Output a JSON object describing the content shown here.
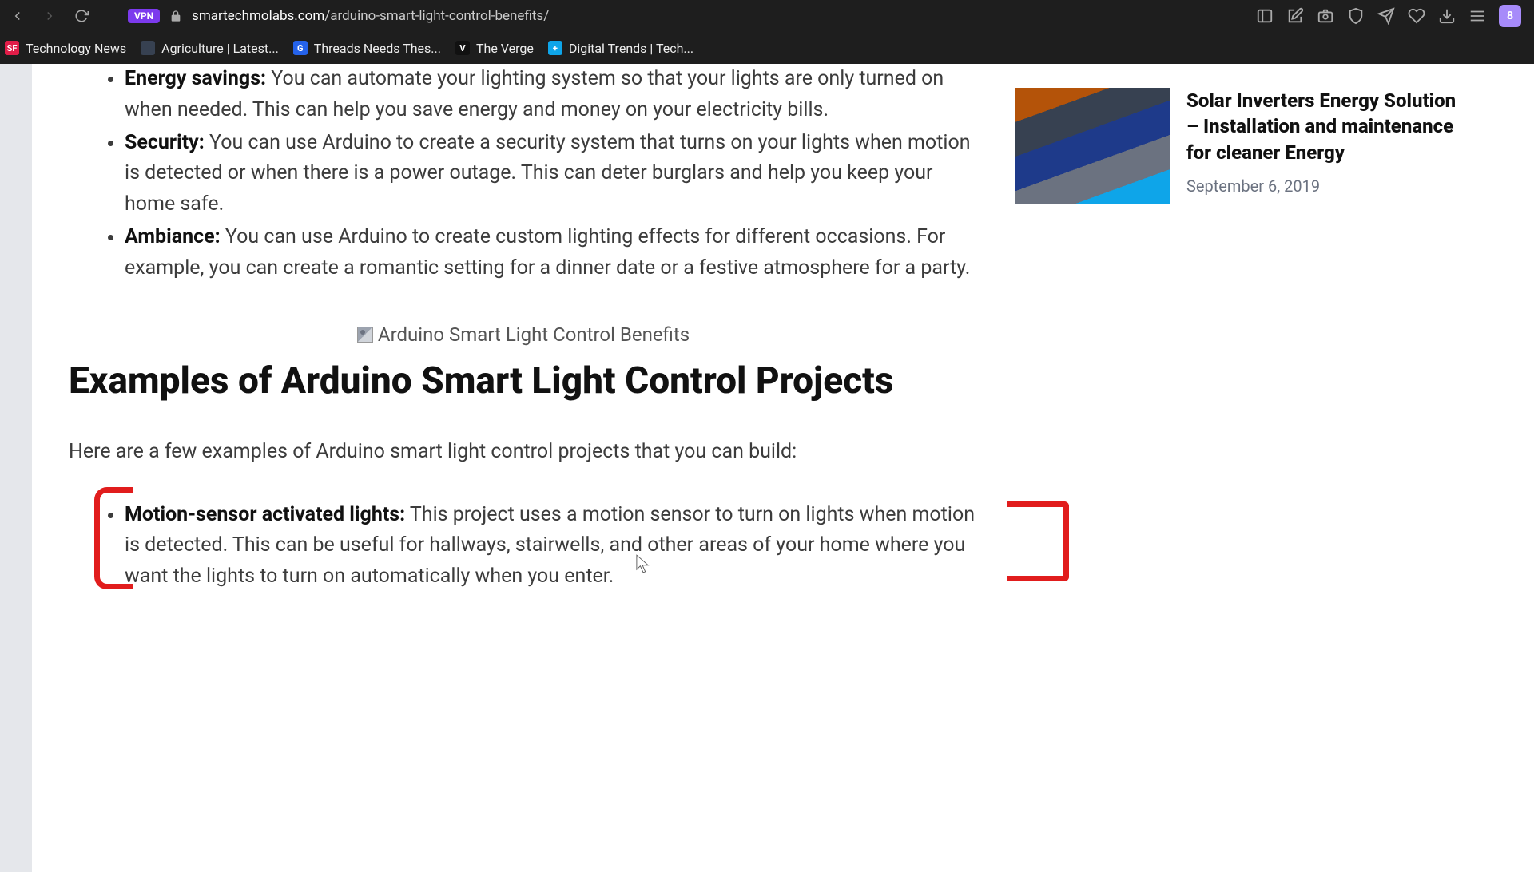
{
  "browser": {
    "url_domain": "smartechmolabs.com",
    "url_path": "/arduino-smart-light-control-benefits/",
    "vpn_label": "VPN",
    "avatar_initial": "8"
  },
  "bookmarks": [
    {
      "icon": "SF",
      "cls": "f-sf",
      "label": "Technology News"
    },
    {
      "icon": "",
      "cls": "f-ag",
      "label": "Agriculture | Latest..."
    },
    {
      "icon": "G",
      "cls": "f-g",
      "label": "Threads Needs Thes..."
    },
    {
      "icon": "V",
      "cls": "f-v",
      "label": "The Verge"
    },
    {
      "icon": "+",
      "cls": "f-dt",
      "label": "Digital Trends | Tech..."
    }
  ],
  "article": {
    "bullets_top": [
      {
        "strong": "Energy savings:",
        "text": " You can automate your lighting system so that your lights are only turned on when needed. This can help you save energy and money on your electricity bills."
      },
      {
        "strong": "Security:",
        "text": " You can use Arduino to create a security system that turns on your lights when motion is detected or when there is a power outage. This can deter burglars and help you keep your home safe."
      },
      {
        "strong": "Ambiance:",
        "text": " You can use Arduino to create custom lighting effects for different occasions. For example, you can create a romantic setting for a dinner date or a festive atmosphere for a party."
      }
    ],
    "broken_image_alt": "Arduino Smart Light Control Benefits",
    "h2": "Examples of Arduino Smart Light Control Projects",
    "intro": "Here are a few examples of Arduino smart light control projects that you can build:",
    "bullets_bottom": [
      {
        "strong": "Motion-sensor activated lights:",
        "text": " This project uses a motion sensor to turn on lights when motion is detected. This can be useful for hallways, stairwells, and other areas of your home where you want the lights to turn on automatically when you enter."
      }
    ]
  },
  "sidebar": {
    "related": {
      "title": "Solar Inverters Energy Solution – Installation and maintenance for cleaner Energy",
      "date": "September 6, 2019"
    }
  }
}
